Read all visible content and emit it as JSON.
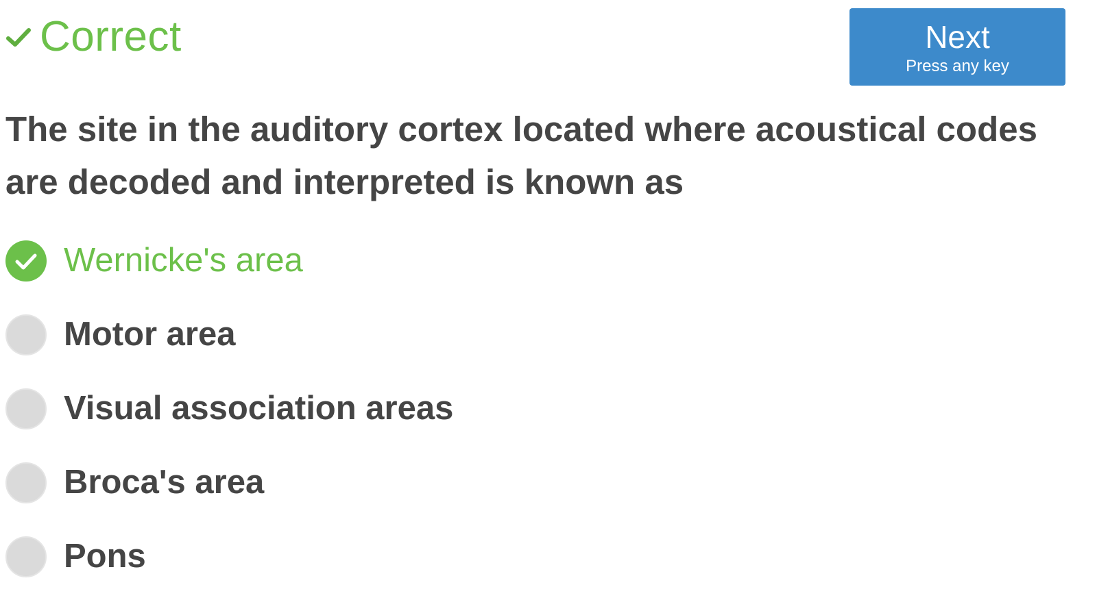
{
  "header": {
    "status_text": "Correct",
    "status_icon": "check-icon",
    "status_color": "#6cc04a",
    "next_button": {
      "label": "Next",
      "hint": "Press any key",
      "color": "#3d8acb"
    }
  },
  "question": {
    "text": "The site in the auditory cortex located where acoustical codes are decoded and interpreted is known as"
  },
  "options": [
    {
      "label": "Wernicke's area",
      "state": "correct",
      "icon": "check-circle-icon"
    },
    {
      "label": "Motor area",
      "state": "unselected",
      "icon": "radio-empty-icon"
    },
    {
      "label": "Visual association areas",
      "state": "unselected",
      "icon": "radio-empty-icon"
    },
    {
      "label": "Broca's area",
      "state": "unselected",
      "icon": "radio-empty-icon"
    },
    {
      "label": "Pons",
      "state": "unselected",
      "icon": "radio-empty-icon"
    }
  ]
}
